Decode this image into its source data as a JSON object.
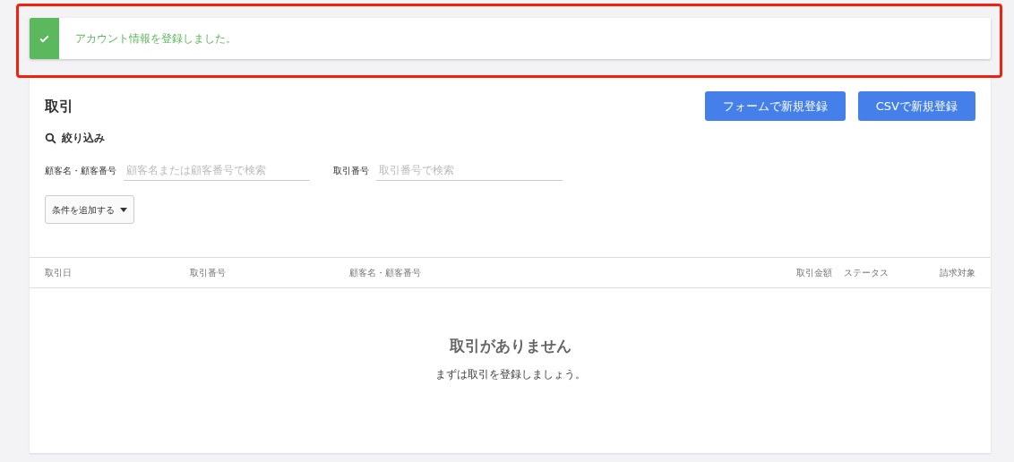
{
  "toast": {
    "message": "アカウント情報を登録しました。",
    "kind": "success"
  },
  "page": {
    "title": "取引",
    "buttons": [
      "フォームで新規登録",
      "CSVで新規登録"
    ]
  },
  "filter": {
    "heading": "絞り込み",
    "fields": [
      {
        "label": "顧客名・顧客番号",
        "placeholder": "顧客名または顧客番号で検索"
      },
      {
        "label": "取引番号",
        "placeholder": "取引番号で検索"
      }
    ],
    "add_condition": "条件を追加する"
  },
  "table": {
    "columns": [
      "取引日",
      "取引番号",
      "顧客名・顧客番号",
      "取引金額",
      "ステータス",
      "請求対象"
    ],
    "empty_title": "取引がありません",
    "empty_message": "まずは取引を登録しましょう。"
  }
}
